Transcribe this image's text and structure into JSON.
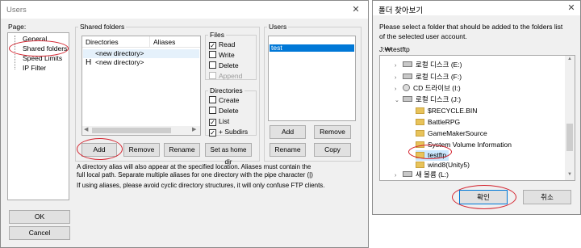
{
  "users_dialog": {
    "title": "Users",
    "close_glyph": "✕",
    "page_label": "Page:",
    "pages": [
      "General",
      "Shared folders",
      "Speed Limits",
      "IP Filter"
    ],
    "shared_folders_group": "Shared folders",
    "columns": [
      "Directories",
      "Aliases"
    ],
    "rows": [
      {
        "marker": "",
        "name": "<new directory>"
      },
      {
        "marker": "H",
        "name": "<new directory>"
      }
    ],
    "files_group": "Files",
    "files_perms": [
      {
        "label": "Read",
        "checked": true,
        "disabled": false
      },
      {
        "label": "Write",
        "checked": false,
        "disabled": false
      },
      {
        "label": "Delete",
        "checked": false,
        "disabled": false
      },
      {
        "label": "Append",
        "checked": false,
        "disabled": true
      }
    ],
    "dirs_group": "Directories",
    "dirs_perms": [
      {
        "label": "Create",
        "checked": false
      },
      {
        "label": "Delete",
        "checked": false
      },
      {
        "label": "List",
        "checked": true
      },
      {
        "label": "+ Subdirs",
        "checked": true
      }
    ],
    "buttons": {
      "add": "Add",
      "remove": "Remove",
      "rename": "Rename",
      "set_home": "Set as home dir",
      "ok": "OK",
      "cancel": "Cancel"
    },
    "users_group": "Users",
    "users": [
      "test"
    ],
    "users_buttons": {
      "add": "Add",
      "remove": "Remove",
      "rename": "Rename",
      "copy": "Copy"
    },
    "info1": "A directory alias will also appear at the specified location. Aliases must contain the full local path. Separate multiple aliases for one directory with the pipe character (|)",
    "info2": "If using aliases, please avoid cyclic directory structures, it will only confuse FTP clients."
  },
  "browse_dialog": {
    "title": "폴더 찾아보기",
    "close_glyph": "✕",
    "instruction": "Please select a folder that should be added to the folders list of the selected user account.",
    "path": "J:₩testftp",
    "tree": [
      {
        "label": "로컬 디스크 (E:)",
        "icon": "drive-icon",
        "expander": "›",
        "indent": 0
      },
      {
        "label": "로컬 디스크 (F:)",
        "icon": "drive-icon",
        "expander": "›",
        "indent": 0
      },
      {
        "label": "CD 드라이브 (I:)",
        "icon": "cd-icon",
        "expander": "›",
        "indent": 0
      },
      {
        "label": "로컬 디스크 (J:)",
        "icon": "drive-icon",
        "expander": "⌄",
        "indent": 0
      },
      {
        "label": "$RECYCLE.BIN",
        "icon": "folder-icon",
        "expander": "",
        "indent": 1
      },
      {
        "label": "BattleRPG",
        "icon": "folder-icon",
        "expander": "",
        "indent": 1
      },
      {
        "label": "GameMakerSource",
        "icon": "folder-icon",
        "expander": "",
        "indent": 1
      },
      {
        "label": "System Volume Information",
        "icon": "folder-icon",
        "expander": "",
        "indent": 1
      },
      {
        "label": "testftp",
        "icon": "folder-icon",
        "expander": "",
        "indent": 1
      },
      {
        "label": "wind8(Unity5)",
        "icon": "folder-icon",
        "expander": "",
        "indent": 1
      },
      {
        "label": "새 볼륨 (L:)",
        "icon": "drive-icon",
        "expander": "›",
        "indent": 0
      },
      {
        "label": "",
        "icon": "network-icon",
        "expander": "›",
        "indent": 0
      }
    ],
    "ok": "확인",
    "cancel": "취소"
  },
  "colors": {
    "annotation": "#d4242f",
    "selection": "#cce8ff",
    "focus_blue": "#0078d7"
  }
}
